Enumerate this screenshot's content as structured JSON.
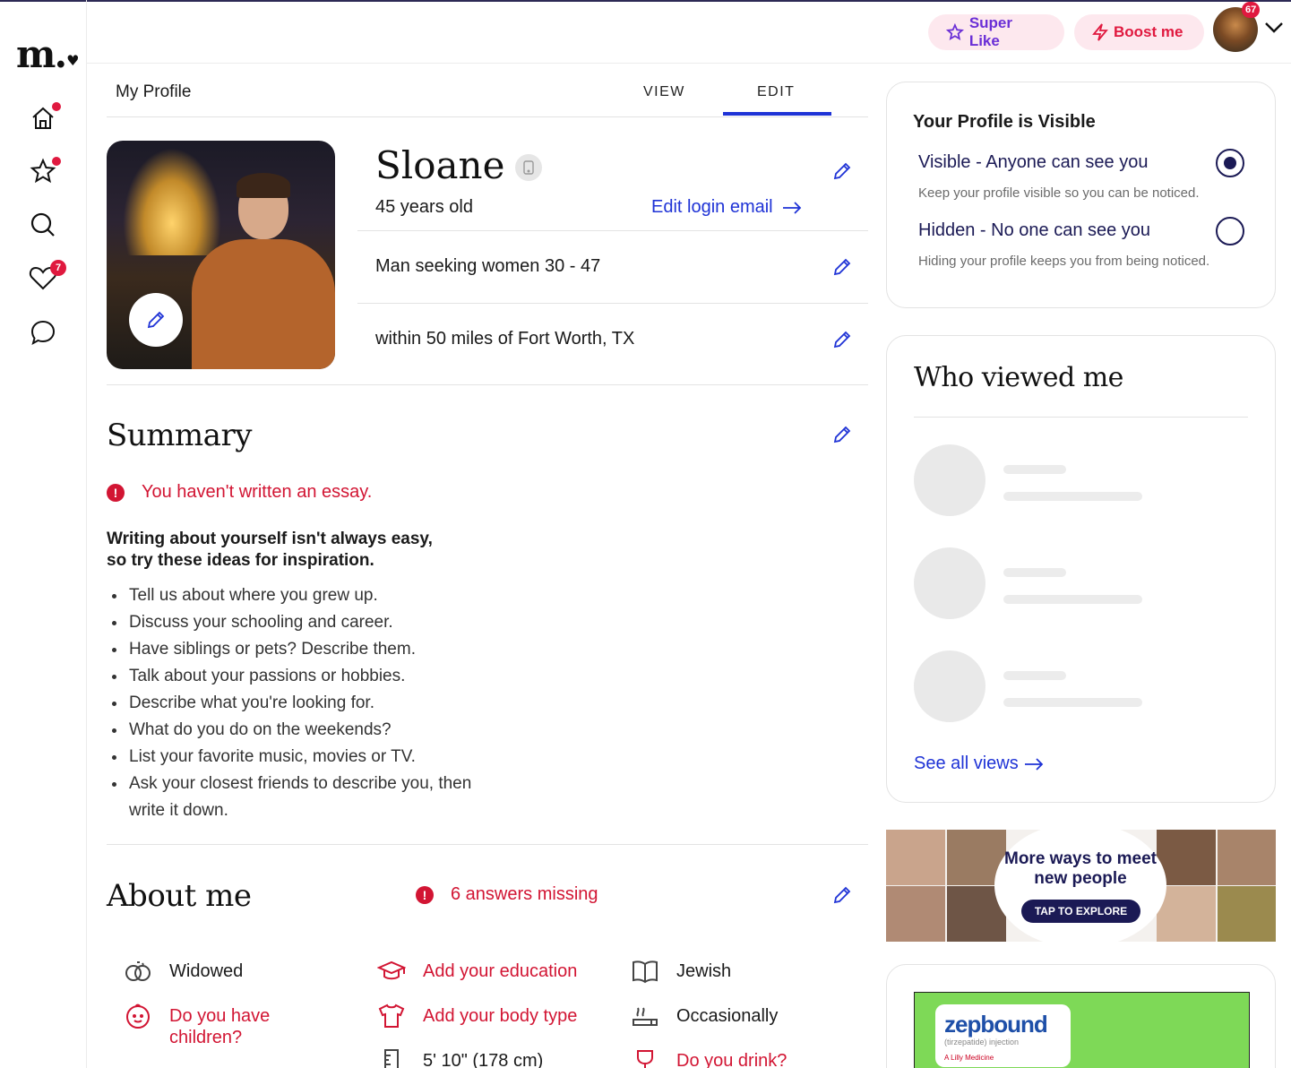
{
  "header": {
    "super_like": "Super Like",
    "boost": "Boost me",
    "avatar_badge": "67"
  },
  "nav": {
    "logo": "m.",
    "likes_badge": "7"
  },
  "tabs": {
    "title": "My Profile",
    "view": "VIEW",
    "edit": "EDIT",
    "active": "EDIT"
  },
  "profile": {
    "name": "Sloane",
    "age": "45 years old",
    "edit_login_email": "Edit login email",
    "seeking": "Man seeking women 30 - 47",
    "location": "within 50 miles of Fort Worth, TX"
  },
  "summary": {
    "title": "Summary",
    "warning": "You haven't written an essay.",
    "tip_heading_1": "Writing about yourself isn't always easy,",
    "tip_heading_2": "so try these ideas for inspiration.",
    "tips": [
      "Tell us about where you grew up.",
      "Discuss your schooling and career.",
      "Have siblings or pets? Describe them.",
      "Talk about your passions or hobbies.",
      "Describe what you're looking for.",
      "What do you do on the weekends?",
      "List your favorite music, movies or TV.",
      "Ask your closest friends to describe you, then write it down."
    ]
  },
  "about": {
    "title": "About me",
    "missing": "6 answers missing",
    "items": {
      "relationship": "Widowed",
      "education": "Add your education",
      "religion": "Jewish",
      "children": "Do you have children?",
      "body_type": "Add your body type",
      "smoking": "Occasionally",
      "height": "5' 10\" (178 cm)",
      "drink": "Do you drink?"
    }
  },
  "visibility": {
    "title": "Your Profile is Visible",
    "visible_label": "Visible - Anyone can see you",
    "visible_sub": "Keep your profile visible so you can be noticed.",
    "hidden_label": "Hidden - No one can see you",
    "hidden_sub": "Hiding your profile keeps you from being noticed.",
    "selected": "visible"
  },
  "viewed": {
    "title": "Who viewed me",
    "see_all": "See all views"
  },
  "ads": {
    "explore_text": "More ways to meet new people",
    "explore_button": "TAP TO EXPLORE",
    "zep_brand": "zepbound",
    "zep_sub": "(tirzepatide) injection",
    "zep_maker": "A Lilly Medicine"
  },
  "colors": {
    "accent_blue": "#1f33d6",
    "alert_red": "#d21533",
    "navy": "#1b1a55",
    "pill_bg": "#fde8ee"
  }
}
